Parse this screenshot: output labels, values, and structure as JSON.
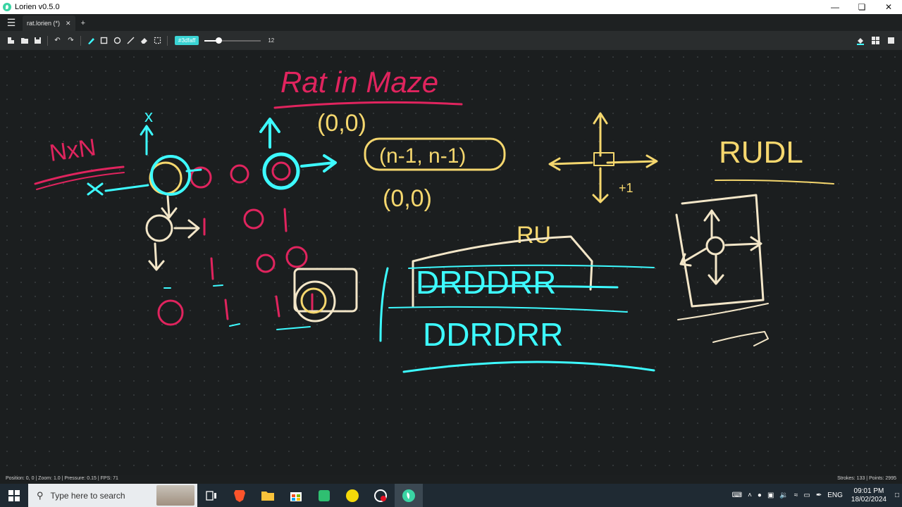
{
  "window": {
    "title": "Lorien v0.5.0"
  },
  "tabs": [
    {
      "label": "rat.lorien (*)"
    }
  ],
  "toolbar": {
    "color_label": "#3dfaff",
    "brush_size": "12",
    "brush_fraction": 0.25
  },
  "canvas": {
    "title": "Rat in Maze",
    "nxn": "NxN",
    "origin": "(0,0)",
    "target": "(n-1, n-1)",
    "origin2": "(0,0)",
    "rudl": "RUDL",
    "ru": "RU",
    "path1": "DRDDRR",
    "path2": "DDRDRR",
    "labels": {
      "x": "x",
      "one": "+1"
    }
  },
  "status": {
    "left": "Position: 0, 0 | Zoom: 1.0 | Pressure: 0.15 | FPS: 71",
    "right": "Strokes: 133 | Points: 2995"
  },
  "taskbar": {
    "search_placeholder": "Type here to search",
    "language": "ENG",
    "time": "09:01 PM",
    "date": "18/02/2024"
  },
  "colors": {
    "accent": "#3dfaff",
    "pink": "#e0245e",
    "yellow": "#f5d76e",
    "cream": "#f3e6c8"
  }
}
